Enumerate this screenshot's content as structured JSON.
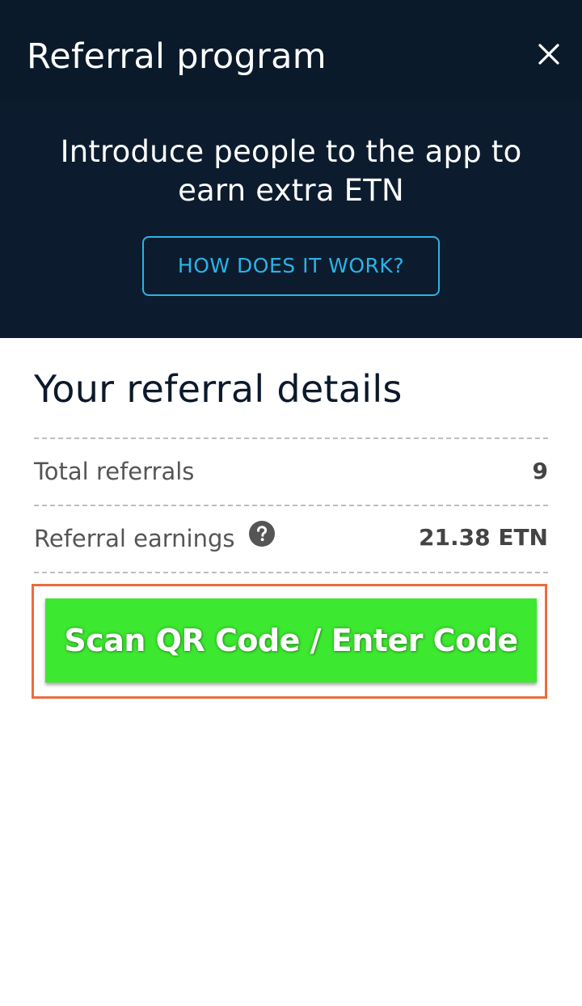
{
  "header": {
    "title": "Referral program",
    "close_icon": "close-icon",
    "background": "#0b1a2b"
  },
  "hero": {
    "text": "Introduce people to the app to earn extra ETN",
    "how_button_label": "HOW DOES IT WORK?",
    "accent": "#2bb3e6"
  },
  "details": {
    "title": "Your referral details",
    "rows": [
      {
        "label": "Total referrals",
        "value": "9"
      },
      {
        "label": "Referral earnings",
        "value": "21.38 ETN",
        "info_icon": "help-circle-icon"
      }
    ]
  },
  "scan": {
    "button_label": "Scan QR Code / Enter Code",
    "button_color": "#3de830",
    "outline_color": "#ee6b3b"
  }
}
